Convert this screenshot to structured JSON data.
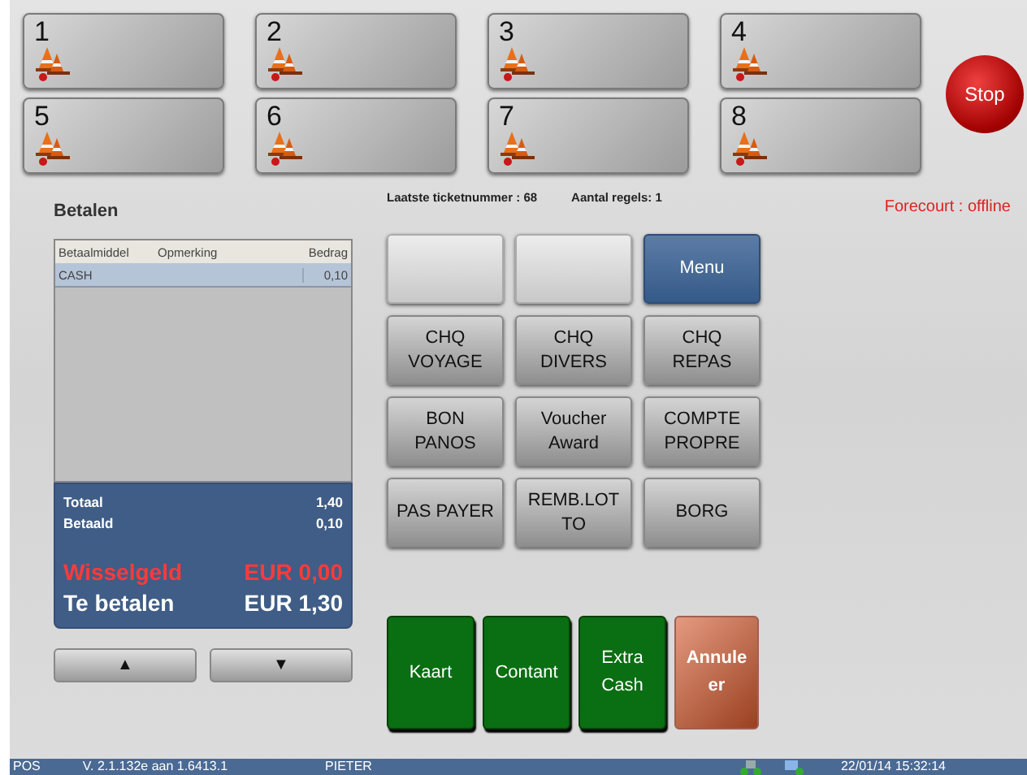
{
  "pumps": [
    {
      "number": "1"
    },
    {
      "number": "2"
    },
    {
      "number": "3"
    },
    {
      "number": "4"
    },
    {
      "number": "5"
    },
    {
      "number": "6"
    },
    {
      "number": "7"
    },
    {
      "number": "8"
    }
  ],
  "stop_button": "Stop",
  "title": "Betalen",
  "info": {
    "ticket": "Laatste ticketnummer : 68",
    "lines": "Aantal regels: 1",
    "forecourt": "Forecourt : offline"
  },
  "table": {
    "columns": [
      "Betaalmiddel",
      "Opmerking",
      "Bedrag"
    ],
    "rows": [
      {
        "betaalmiddel": "CASH",
        "bedrag": "0,10",
        "selected": true
      }
    ]
  },
  "summary": {
    "rows": [
      {
        "label": "Totaal",
        "value": "1,40"
      },
      {
        "label": "Betaald",
        "value": "0,10"
      }
    ],
    "wisselgeld": {
      "label": "Wisselgeld",
      "value": "EUR 0,00"
    },
    "te_betalen": {
      "label": "Te betalen",
      "value": "EUR 1,30"
    }
  },
  "scroll_buttons": [
    "▲",
    "▼"
  ],
  "payment_buttons": [
    {
      "kind": "blank"
    },
    {
      "kind": "blank"
    },
    {
      "kind": "menu",
      "lines": [
        "Menu"
      ]
    },
    {
      "kind": "normal",
      "lines": [
        "CHQ",
        "VOYAGE"
      ]
    },
    {
      "kind": "normal",
      "lines": [
        "CHQ",
        "DIVERS"
      ]
    },
    {
      "kind": "normal",
      "lines": [
        "CHQ",
        "REPAS"
      ]
    },
    {
      "kind": "normal",
      "lines": [
        "BON",
        "PANOS"
      ]
    },
    {
      "kind": "normal",
      "lines": [
        "Voucher",
        "Award"
      ]
    },
    {
      "kind": "normal",
      "lines": [
        "COMPTE",
        "PROPRE"
      ]
    },
    {
      "kind": "normal",
      "lines": [
        "PAS PAYER"
      ]
    },
    {
      "kind": "normal",
      "lines": [
        "REMB.LOT",
        "TO"
      ]
    },
    {
      "kind": "normal",
      "lines": [
        "BORG"
      ]
    }
  ],
  "action_buttons": [
    {
      "kind": "confirm",
      "lines": [
        "Kaart"
      ]
    },
    {
      "kind": "confirm",
      "lines": [
        "Contant"
      ]
    },
    {
      "kind": "confirm",
      "lines": [
        "Extra",
        "Cash"
      ]
    },
    {
      "kind": "cancel",
      "lines": [
        "Annule",
        "er"
      ]
    }
  ],
  "status_bar": {
    "app": "POS",
    "version": "V. 2.1.132e aan 1.6413.1",
    "user": "PIETER",
    "datetime": "22/01/14  15:32:14"
  }
}
